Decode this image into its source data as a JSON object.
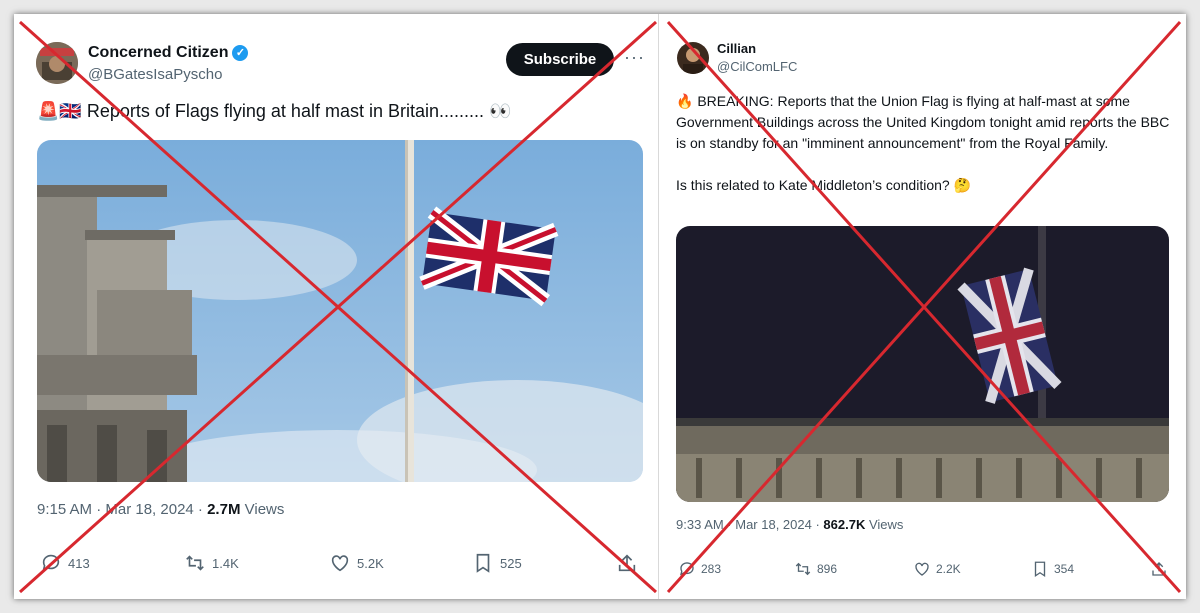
{
  "left_tweet": {
    "author_name": "Concerned Citizen",
    "handle": "@BGatesIsaPyscho",
    "verified": true,
    "subscribe_label": "Subscribe",
    "more_label": "···",
    "flag_emojis": "🚨🇬🇧",
    "text": "Reports of Flags flying at half mast in Britain......... 👀",
    "time": "9:15 AM · Mar 18, 2024 · ",
    "views_count": "2.7M",
    "views_label": "Views",
    "replies": "413",
    "reposts": "1.4K",
    "likes": "5.2K",
    "bookmarks": "525"
  },
  "right_tweet": {
    "author_name": "Cillian",
    "handle": "@CilComLFC",
    "text_line1": "🔥 BREAKING: Reports that the Union Flag is flying at half-mast at some Government Buildings across the United Kingdom tonight amid reports the BBC is on standby for an \"imminent announcement\" from the Royal Family.",
    "text_line2": "Is this related to Kate Middleton’s condition? 🤔",
    "more_label": "···",
    "time": "9:33 AM · Mar 18, 2024 · ",
    "views_count": "862.7K",
    "views_label": "Views",
    "replies": "283",
    "reposts": "896",
    "likes": "2.2K",
    "bookmarks": "354"
  },
  "colors": {
    "x_mark": "#d7282f",
    "verified_blue": "#1d9bf0",
    "muted_text": "#536471"
  },
  "icons": [
    "verified-badge-icon",
    "reply-icon",
    "repost-icon",
    "like-icon",
    "bookmark-icon",
    "share-icon",
    "more-icon"
  ]
}
